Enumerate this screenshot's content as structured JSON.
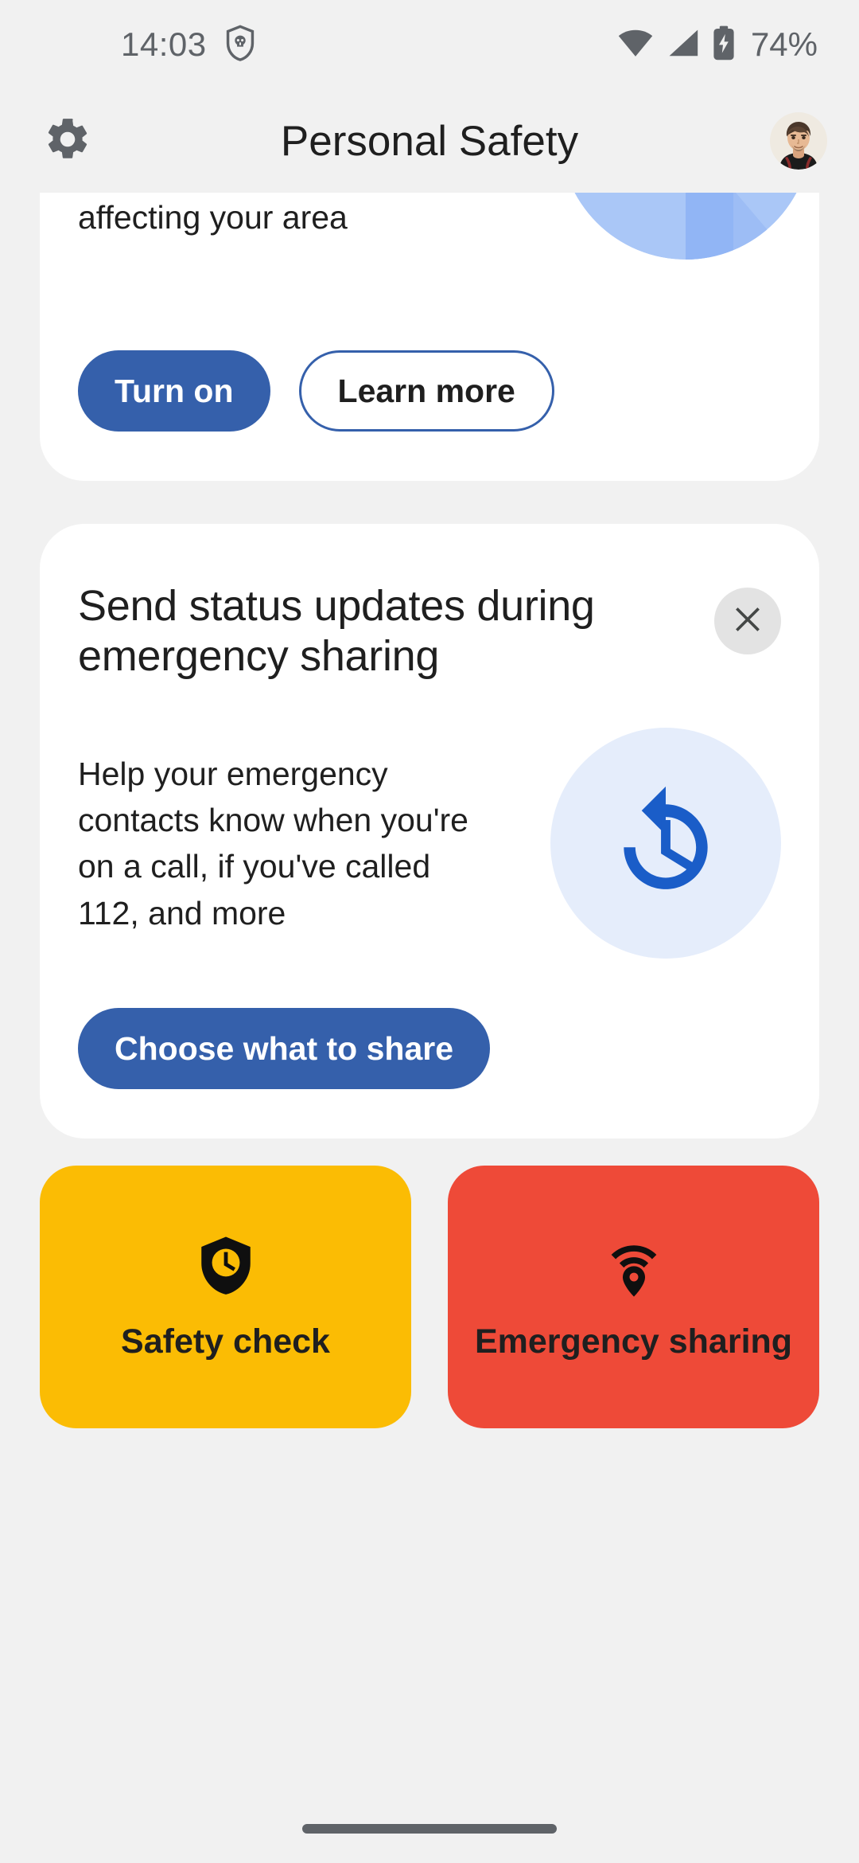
{
  "status_bar": {
    "time": "14:03",
    "icons": [
      "shield-skull-icon",
      "wifi-icon",
      "cellular-signal-icon",
      "battery-charging-icon"
    ],
    "battery_percent": "74%"
  },
  "app_bar": {
    "settings_icon": "gear-icon",
    "title": "Personal Safety",
    "avatar": "user-avatar"
  },
  "cards": {
    "alerts": {
      "text": "affecting your area",
      "primary_button": "Turn on",
      "secondary_button": "Learn more",
      "art": "crisis-alerts-illustration"
    },
    "status_updates": {
      "title": "Send status updates during emergency sharing",
      "close_icon": "close-icon",
      "description": "Help your emergency contacts know when you're on a call, if you've called 112, and more",
      "icon": "update-clock-icon",
      "cta_button": "Choose what to share"
    }
  },
  "tiles": [
    {
      "label": "Safety check",
      "icon": "shield-clock-icon",
      "color": "#fbbc04"
    },
    {
      "label": "Emergency sharing",
      "icon": "location-broadcast-icon",
      "color": "#ee4a38"
    }
  ],
  "navigation": {
    "handle": "gesture-home-handle"
  },
  "colors": {
    "background": "#f1f1f1",
    "card": "#ffffff",
    "accent_blue": "#3560ab",
    "icon_blue": "#1a5dc8",
    "icon_blue_bg": "#e5edfb",
    "yellow": "#fbbc04",
    "red": "#ee4a38",
    "text": "#1f1f1f",
    "muted": "#5f6368"
  }
}
